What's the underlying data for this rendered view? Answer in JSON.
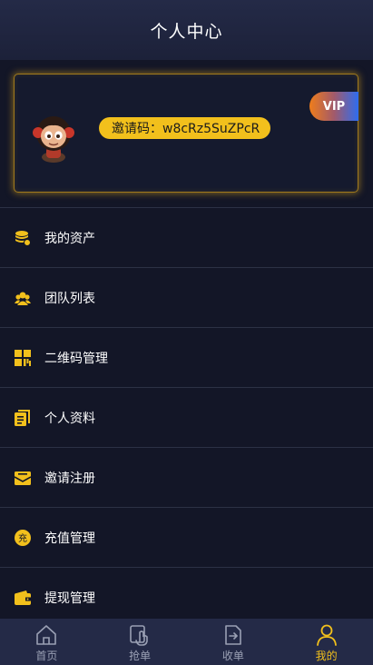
{
  "header": {
    "title": "个人中心"
  },
  "profile": {
    "invite_label": "邀请码：w8cRz5SuZPcR",
    "vip_badge": "VIP"
  },
  "menu": {
    "items": [
      {
        "label": "我的资产",
        "icon": "coins-icon"
      },
      {
        "label": "团队列表",
        "icon": "team-icon"
      },
      {
        "label": "二维码管理",
        "icon": "qrcode-icon"
      },
      {
        "label": "个人资料",
        "icon": "profile-doc-icon"
      },
      {
        "label": "邀请注册",
        "icon": "invite-mail-icon"
      },
      {
        "label": "充值管理",
        "icon": "recharge-icon"
      },
      {
        "label": "提现管理",
        "icon": "wallet-icon"
      }
    ]
  },
  "tabbar": {
    "items": [
      {
        "label": "首页",
        "icon": "home-icon",
        "active": false
      },
      {
        "label": "抢单",
        "icon": "grab-order-icon",
        "active": false
      },
      {
        "label": "收单",
        "icon": "receive-order-icon",
        "active": false
      },
      {
        "label": "我的",
        "icon": "user-icon",
        "active": true
      }
    ]
  },
  "colors": {
    "background": "#131627",
    "header": "#242a47",
    "accent": "#f2c01c",
    "inactive_tab": "#9aa0b4"
  }
}
